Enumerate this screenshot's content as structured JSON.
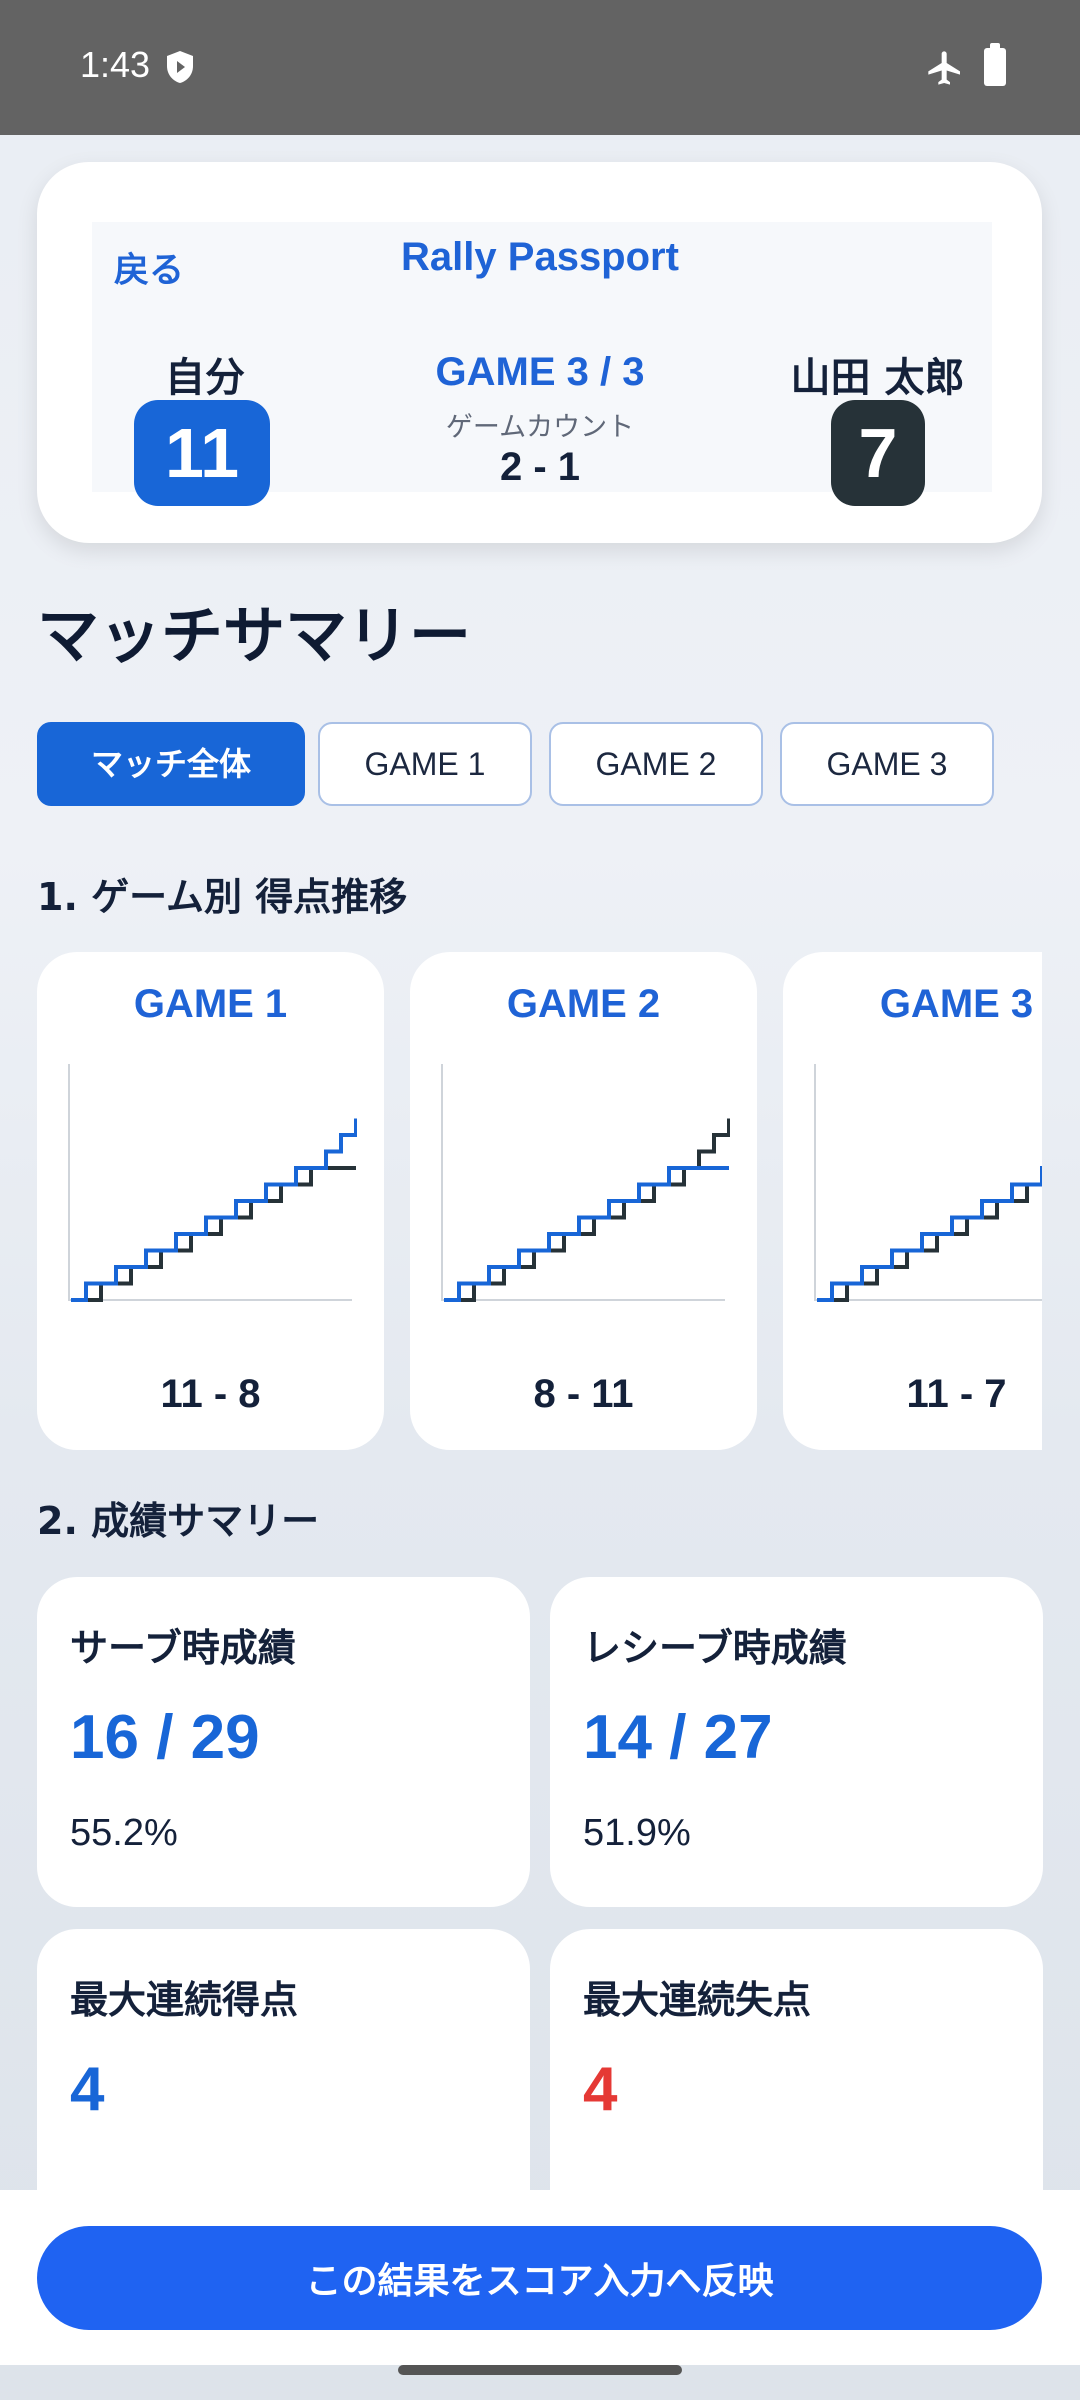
{
  "status_bar": {
    "time": "1:43",
    "icons": [
      "shield-icon",
      "airplane-icon",
      "battery-icon"
    ]
  },
  "header": {
    "back_label": "戻る",
    "app_title": "Rally Passport",
    "player_label": "自分",
    "player_score": "11",
    "game_label": "GAME 3 / 3",
    "gamecount_label": "ゲームカウント",
    "gamecount_value": "2 - 1",
    "opponent_label": "山田 太郎",
    "opponent_score": "7"
  },
  "page_title": "マッチサマリー",
  "tabs": [
    {
      "label": "マッチ全体",
      "active": true
    },
    {
      "label": "GAME 1",
      "active": false
    },
    {
      "label": "GAME 2",
      "active": false
    },
    {
      "label": "GAME 3",
      "active": false
    }
  ],
  "section1_title": "1. ゲーム別 得点推移",
  "games": [
    {
      "title": "GAME 1",
      "score": "11 - 8",
      "sequence": "BKBKBKBKBKBKBKBKBBB"
    },
    {
      "title": "GAME 2",
      "score": "8 - 11",
      "sequence": "BKBKBKBKBKBKBKBKKKK"
    },
    {
      "title": "GAME 3",
      "score": "11 - 7",
      "sequence": "BKBKBKBKBKBKBKBBBB"
    }
  ],
  "section2_title": "2. 成績サマリー",
  "stats": [
    {
      "label": "サーブ時成績",
      "value": "16 / 29",
      "percent": "55.2%"
    },
    {
      "label": "レシーブ時成績",
      "value": "14 / 27",
      "percent": "51.9%"
    },
    {
      "label": "最大連続得点",
      "value": "4",
      "percent": ""
    },
    {
      "label": "最大連続失点",
      "value": "4",
      "percent": ""
    }
  ],
  "colors": {
    "accent": "#1866d7",
    "player_line": "#1866d7",
    "opponent_line": "#263238",
    "loss_value": "#e53935",
    "button": "#1f63f2"
  },
  "reflect_button_label": "この結果をスコア入力へ反映"
}
